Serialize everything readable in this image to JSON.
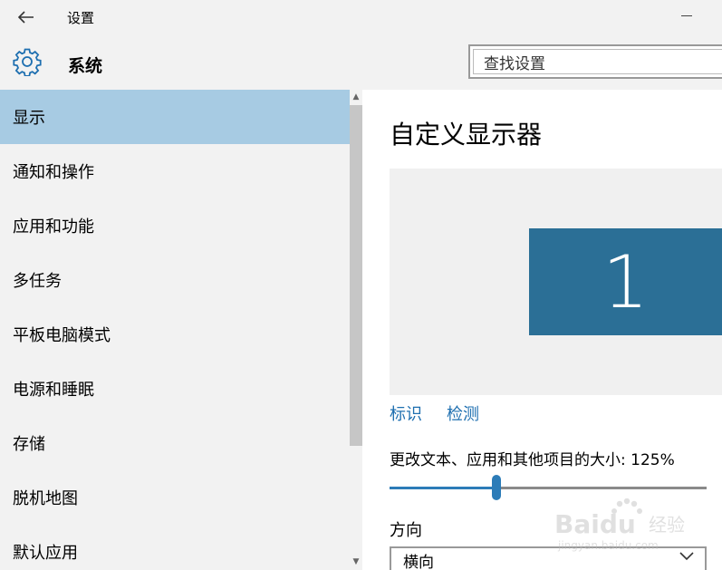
{
  "window": {
    "title": "设置",
    "back_icon": "back-arrow-icon",
    "minimize_icon": "minimize-icon"
  },
  "header": {
    "section_icon": "gear-icon",
    "section_title": "系统",
    "search_placeholder": "查找设置"
  },
  "sidebar": {
    "items": [
      {
        "label": "显示",
        "active": true
      },
      {
        "label": "通知和操作",
        "active": false
      },
      {
        "label": "应用和功能",
        "active": false
      },
      {
        "label": "多任务",
        "active": false
      },
      {
        "label": "平板电脑模式",
        "active": false
      },
      {
        "label": "电源和睡眠",
        "active": false
      },
      {
        "label": "存储",
        "active": false
      },
      {
        "label": "脱机地图",
        "active": false
      },
      {
        "label": "默认应用",
        "active": false
      }
    ],
    "active_color": "#a7cbe3"
  },
  "main": {
    "title": "自定义显示器",
    "monitor_number": "1",
    "monitor_color": "#2b6f96",
    "identify_link": "标识",
    "detect_link": "检测",
    "scale_label": "更改文本、应用和其他项目的大小: 125%",
    "scale_slider_fraction": 0.337,
    "accent_color": "#2c7cb8",
    "orientation_label": "方向",
    "orientation_value": "横向"
  },
  "watermark": {
    "brand": "Baidu",
    "brand_suffix": "经验",
    "url": "jingyan.baidu.com"
  }
}
